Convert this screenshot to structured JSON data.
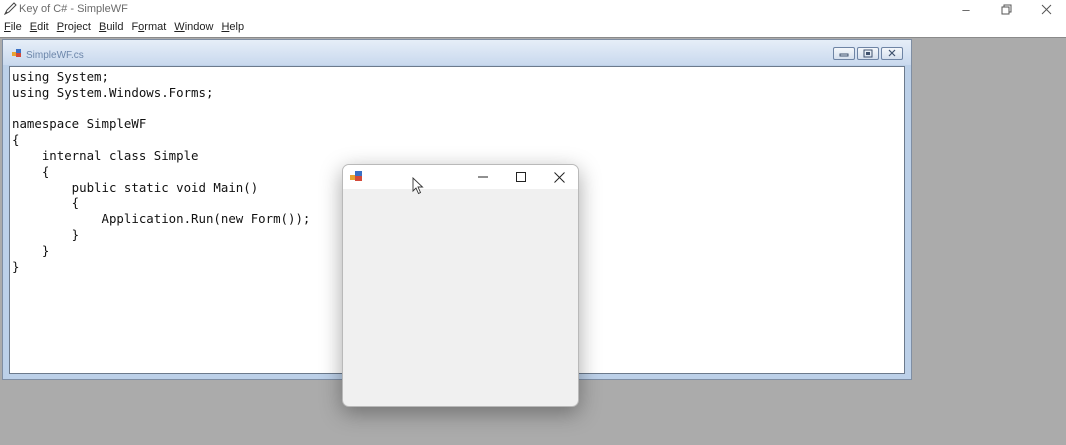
{
  "app": {
    "title": "Key of C# - SimpleWF",
    "menu": [
      "File",
      "Edit",
      "Project",
      "Build",
      "Format",
      "Window",
      "Help"
    ],
    "menu_mnemonics": [
      "F",
      "E",
      "P",
      "B",
      "o",
      "W",
      "H"
    ]
  },
  "child": {
    "title": "SimpleWF.cs",
    "code": [
      "using System;",
      "using System.Windows.Forms;",
      "",
      "namespace SimpleWF",
      "{",
      "    internal class Simple",
      "    {",
      "        public static void Main()",
      "        {",
      "            Application.Run(new Form());",
      "        }",
      "    }",
      "}"
    ]
  },
  "form": {
    "title": ""
  },
  "colors": {
    "mdi_background": "#ababab",
    "child_title": "#c9d9ee",
    "form_body": "#f0f0f0"
  }
}
